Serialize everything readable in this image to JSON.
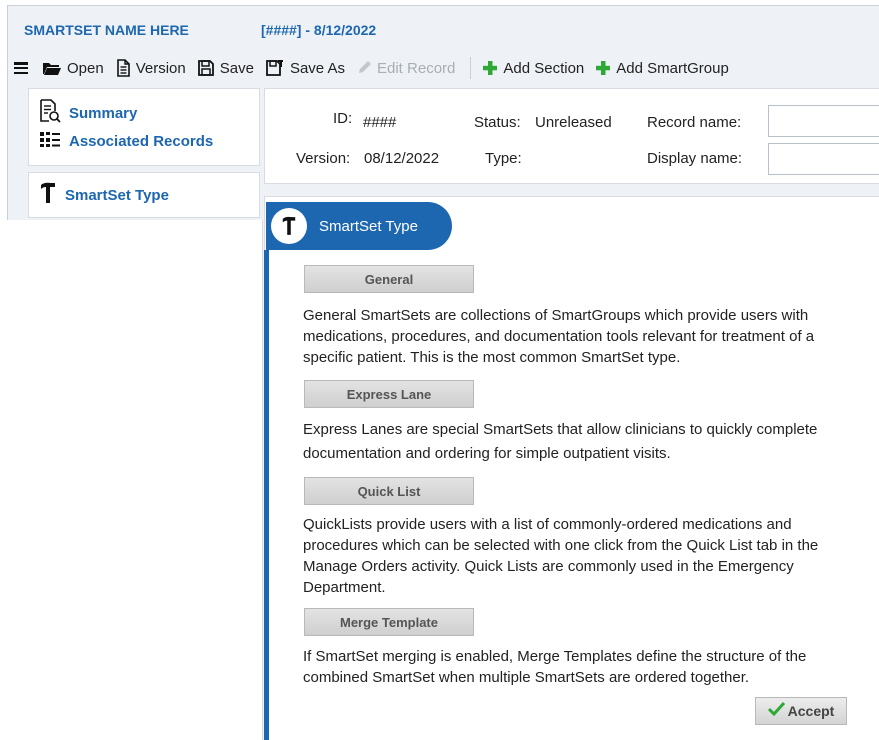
{
  "header": {
    "smartset_name": "SMARTSET NAME HERE",
    "id_date": "[####] - 8/12/2022"
  },
  "toolbar": {
    "open": "Open",
    "version": "Version",
    "save": "Save",
    "save_as": "Save As",
    "edit_record": "Edit Record",
    "add_section": "Add Section",
    "add_smartgroup": "Add SmartGroup"
  },
  "sidebar": {
    "summary": "Summary",
    "associated_records": "Associated Records",
    "smartset_type": "SmartSet Type"
  },
  "record": {
    "id_label": "ID:",
    "id_value": "####",
    "status_label": "Status:",
    "status_value": "Unreleased",
    "record_name_label": "Record name:",
    "record_name_value": "",
    "version_label": "Version:",
    "version_value": "08/12/2022",
    "type_label": "Type:",
    "type_value": "",
    "display_name_label": "Display name:",
    "display_name_value": ""
  },
  "section": {
    "title": "SmartSet Type",
    "types": [
      {
        "button": "General",
        "description": "General SmartSets are collections of SmartGroups which provide users with medications, procedures, and documentation tools relevant for treatment of a specific patient. This is the most common SmartSet type."
      },
      {
        "button": "Express Lane",
        "description": "Express Lanes are special SmartSets that allow clinicians to quickly complete documentation and ordering for simple outpatient visits."
      },
      {
        "button": "Quick List",
        "description": "QuickLists provide users with a list of commonly-ordered medications and procedures which can be selected with one click from the Quick List tab in the Manage Orders activity. Quick Lists are commonly used in the Emergency Department."
      },
      {
        "button": "Merge Template",
        "description": "If SmartSet merging is enabled, Merge Templates define the structure of the combined SmartSet when multiple SmartSets are ordered together."
      }
    ],
    "accept": "Accept"
  },
  "colors": {
    "accent_blue": "#1d67b0",
    "add_green": "#2ea836",
    "disabled_gray": "#a8aeb4"
  },
  "icons": {
    "menu": "hamburger-icon",
    "open": "folder-icon",
    "version": "document-icon",
    "save": "floppy-icon",
    "save_as": "floppy-pencil-icon",
    "edit_record": "pencil-icon",
    "add": "plus-icon",
    "summary": "document-search-icon",
    "associated_records": "records-grid-icon",
    "smartset_type": "hammer-icon",
    "accept": "checkmark-icon"
  }
}
